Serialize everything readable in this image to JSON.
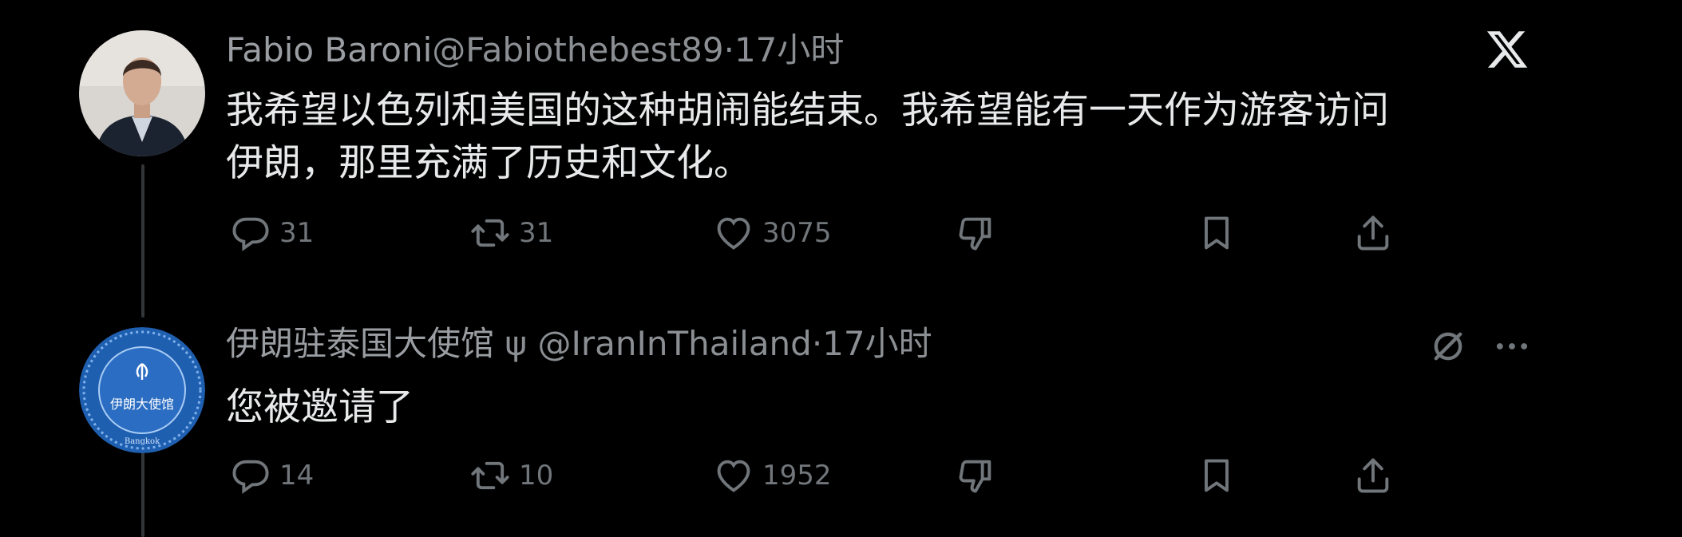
{
  "brand": {
    "logo_icon": "x-logo-icon"
  },
  "tweets": [
    {
      "display_name": "Fabio Baroni",
      "handle": "@Fabiothebest89",
      "separator": "·",
      "time": "17小时",
      "text_lines": [
        "我希望以色列和美国的这种胡闹能结束。我希望能有一天作为游客访问",
        "伊朗，那里充满了历史和文化。"
      ],
      "actions": {
        "replies": "31",
        "reposts": "31",
        "likes": "3075"
      }
    },
    {
      "display_name": "伊朗驻泰国大使馆",
      "badge": "ψ",
      "handle": "@IranInThailand",
      "separator": "·",
      "time": "17小时",
      "avatar_text": "伊朗大使馆",
      "avatar_bottom_text": "Bangkok",
      "text_lines": [
        "您被邀请了"
      ],
      "actions": {
        "replies": "14",
        "reposts": "10",
        "likes": "1952"
      }
    }
  ],
  "colors": {
    "background": "#000000",
    "text": "#e7e9ea",
    "muted": "#71767b",
    "embassy_blue": "#1f5fb0"
  }
}
